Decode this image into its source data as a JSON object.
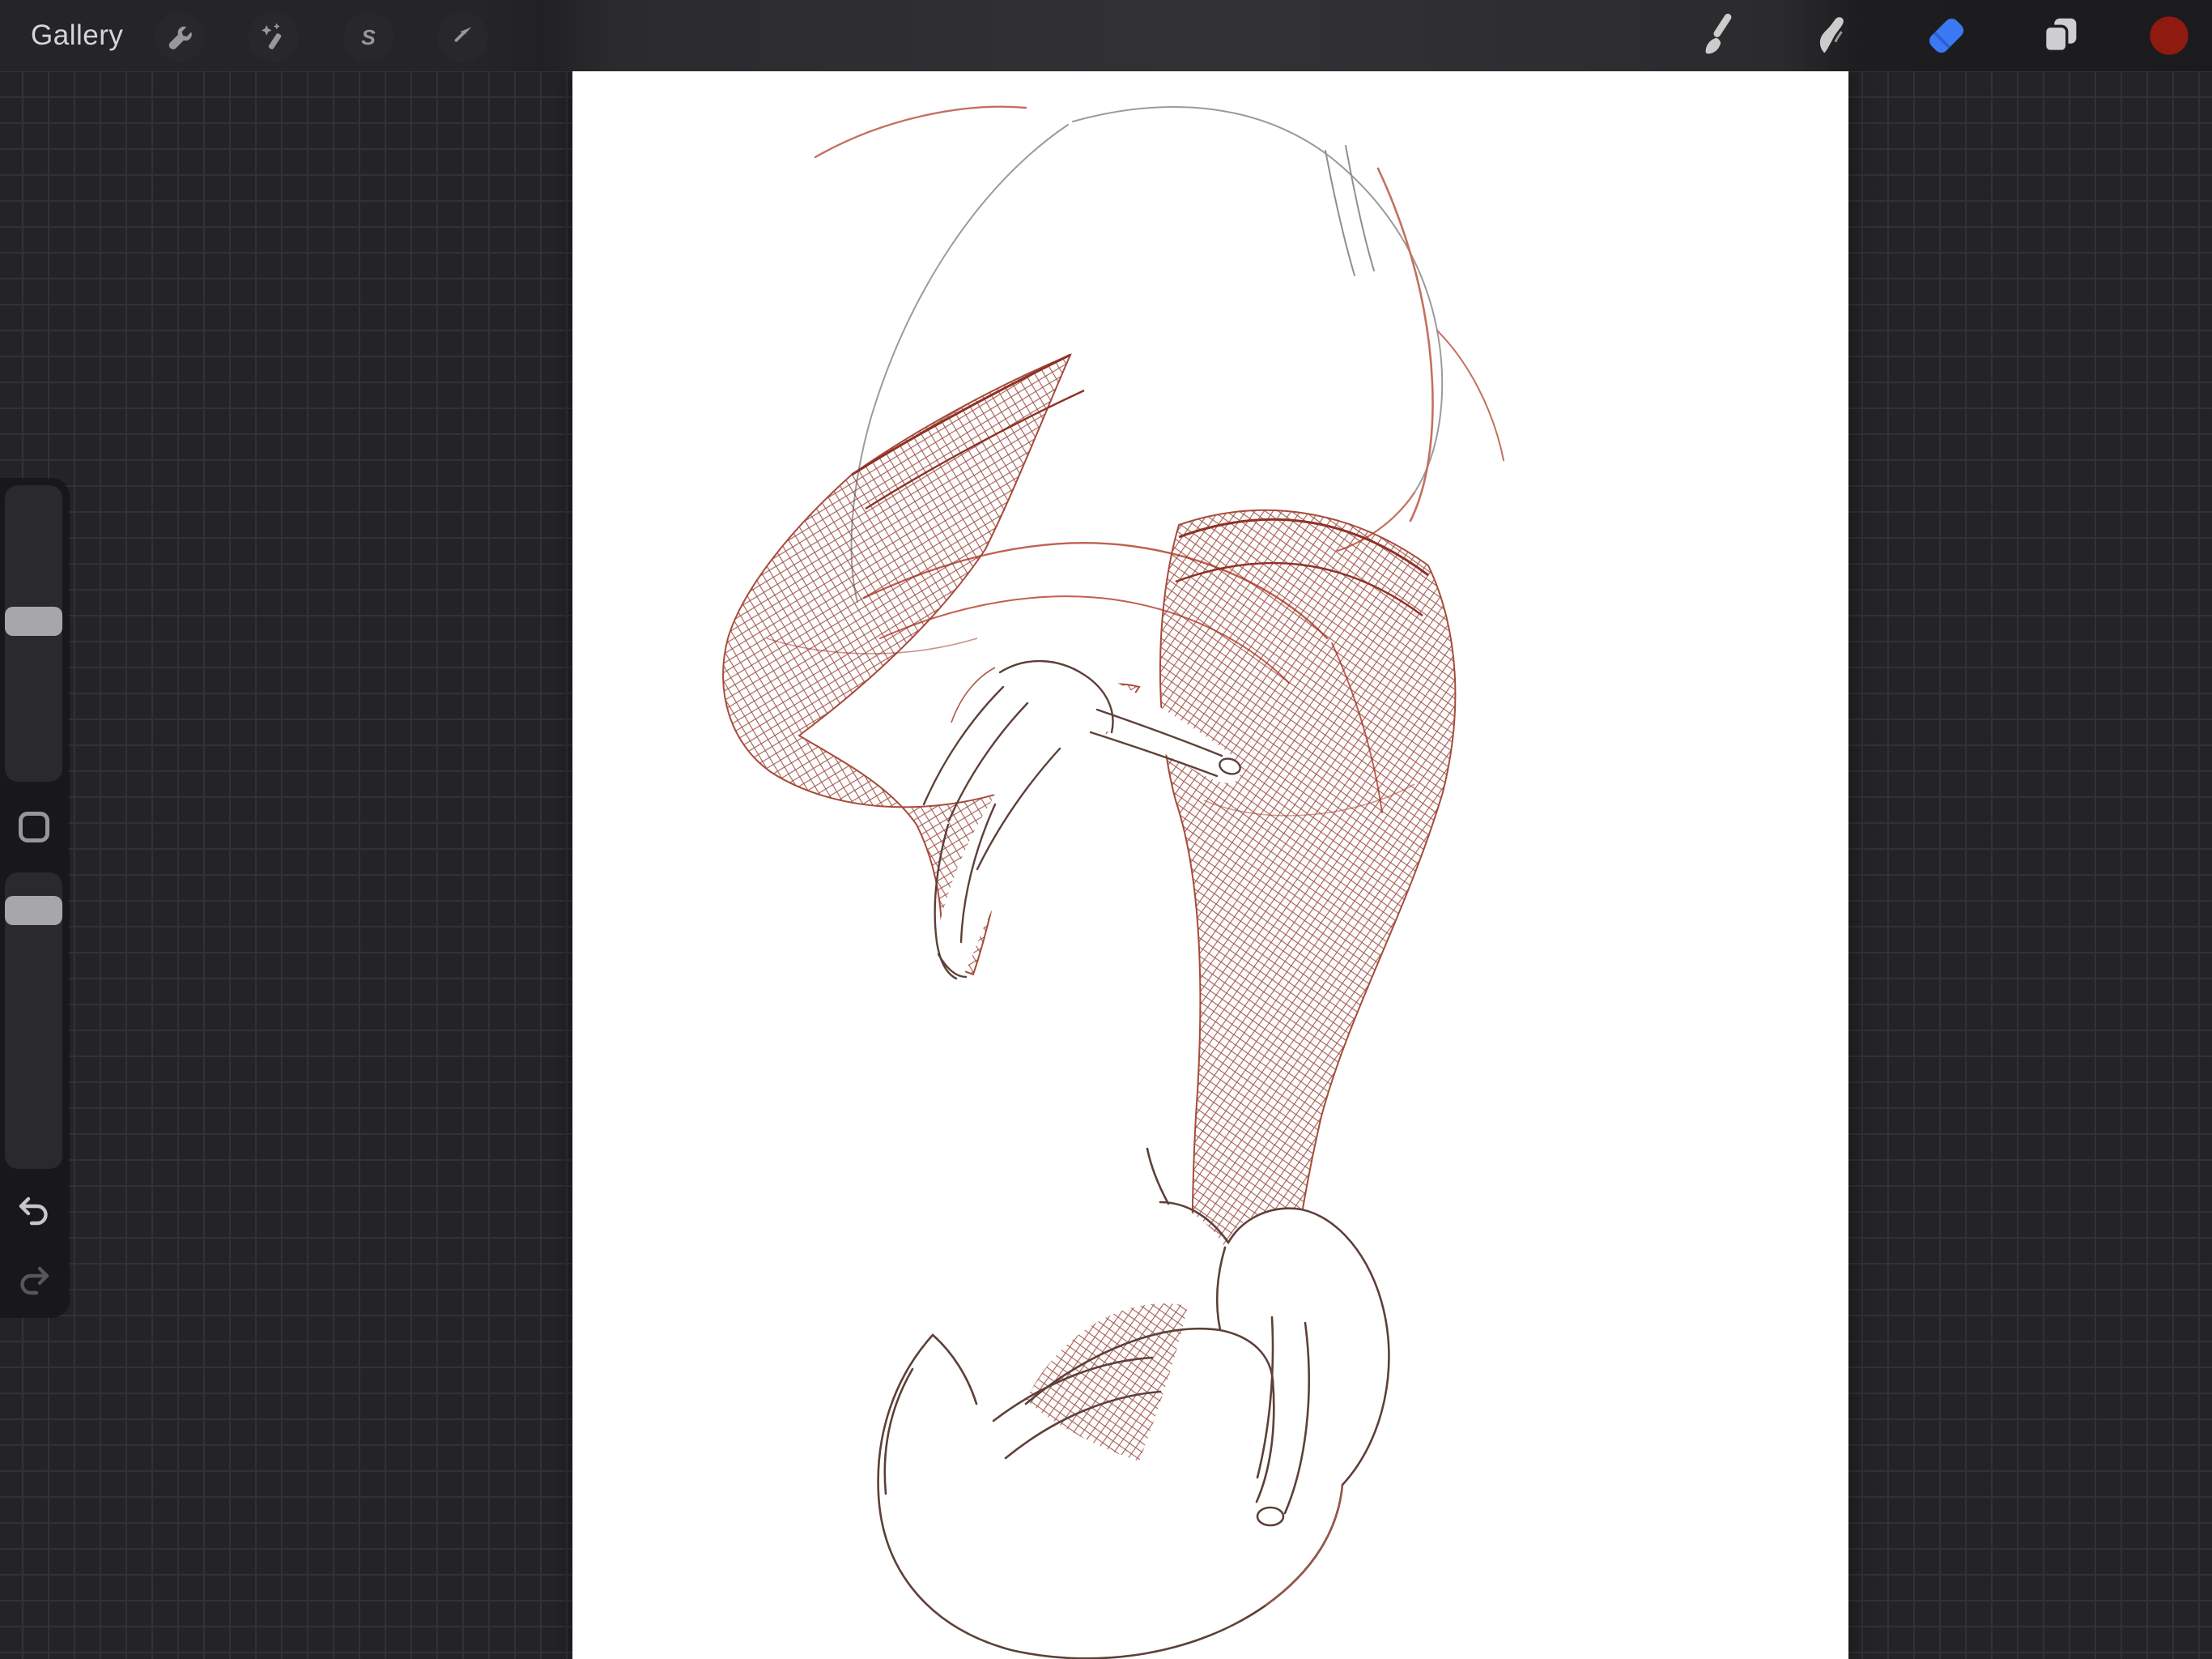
{
  "header": {
    "gallery_label": "Gallery",
    "left_tools": [
      {
        "id": "actions",
        "icon": "wrench-icon"
      },
      {
        "id": "adjustments",
        "icon": "magic-wand-icon"
      },
      {
        "id": "selection",
        "icon": "selection-s-icon"
      },
      {
        "id": "transform",
        "icon": "transform-arrow-icon"
      }
    ],
    "right_tools": [
      {
        "id": "paint",
        "icon": "brush-icon",
        "active": false
      },
      {
        "id": "smudge",
        "icon": "smudge-icon",
        "active": false
      },
      {
        "id": "erase",
        "icon": "eraser-icon",
        "active": true
      },
      {
        "id": "layers",
        "icon": "layers-icon",
        "active": false
      },
      {
        "id": "color",
        "icon": "color-swatch",
        "active": false
      }
    ],
    "selection_letter": "S",
    "active_tool_color": "#3B79F2",
    "eraser_notch_color": "#2A5FD0",
    "selected_paint_color": "#8E1A10",
    "icon_gray": "#98989b",
    "icon_light_gray": "#cccccd"
  },
  "sidebar": {
    "brush_size_handle_percent": 41,
    "opacity_handle_percent": 8,
    "undo_enabled": true,
    "redo_enabled": false,
    "undo_color": "#c6c6c8",
    "redo_color": "#57575a"
  },
  "canvas": {
    "background": "#ffffff",
    "artwork": "line-art of legs in fishnet stockings with stiletto high-heel sandals, hips in shorts sketched above",
    "ink": {
      "fishnet": "#8e3226",
      "welt_band": "#8e3226",
      "outline_red": "#c4705f",
      "outline_gray": "#9b9b9b",
      "shoe_line": "#5d4038"
    }
  },
  "workspace": {
    "background": "#242427",
    "grid_line": "#323236",
    "grid_size_px": 32
  }
}
